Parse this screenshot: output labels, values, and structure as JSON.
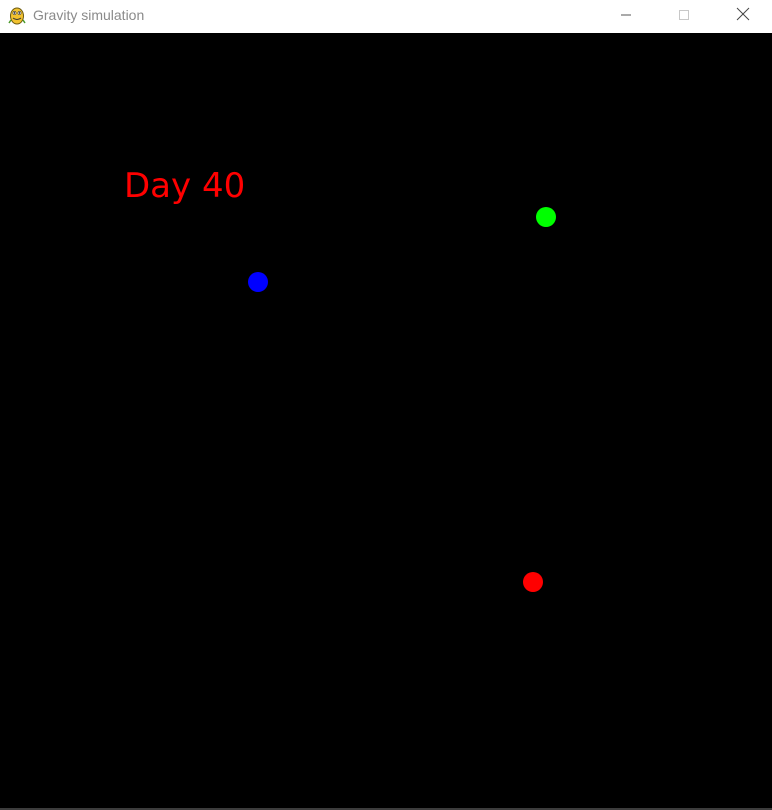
{
  "window": {
    "title": "Gravity simulation",
    "app_icon": "pygame-snake-icon",
    "controls": {
      "minimize_icon": "minimize-icon",
      "maximize_icon": "maximize-icon",
      "close_icon": "close-icon"
    }
  },
  "simulation": {
    "background_color": "#000000",
    "day_label": "Day 40",
    "day_label_color": "#ff0000",
    "bodies": [
      {
        "name": "green-body",
        "color": "#00ff00"
      },
      {
        "name": "blue-body",
        "color": "#0000ff"
      },
      {
        "name": "red-body",
        "color": "#ff0000"
      }
    ]
  }
}
